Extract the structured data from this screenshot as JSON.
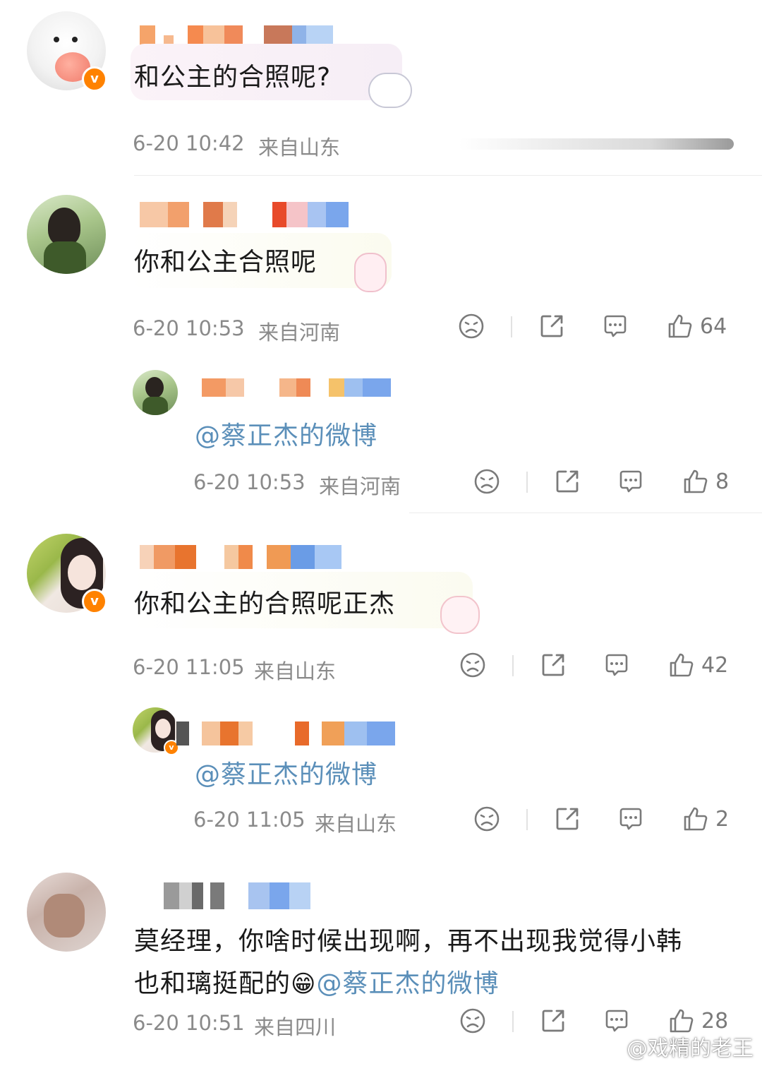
{
  "colors": {
    "accent_orange": "#ff8200",
    "mention_blue": "#5b8fb9",
    "meta_gray": "#8a8a8a"
  },
  "comments": [
    {
      "text": "和公主的合照呢?",
      "date": "6-20 10:42",
      "location": "来自山东",
      "verified": true
    },
    {
      "text": "你和公主合照呢",
      "date": "6-20 10:53",
      "location": "来自河南",
      "likes": "64",
      "verified": false
    },
    {
      "text": "@蔡正杰的微博",
      "date": "6-20 10:53",
      "location": "来自河南",
      "likes": "8",
      "verified": false
    },
    {
      "text": "你和公主的合照呢正杰",
      "date": "6-20 11:05",
      "location": "来自山东",
      "likes": "42",
      "verified": true
    },
    {
      "text": "@蔡正杰的微博",
      "date": "6-20 11:05",
      "location": "来自山东",
      "likes": "2",
      "verified": true
    },
    {
      "text_line1": "莫经理，你啥时候出现啊，再不出现我觉得小韩",
      "text_line2_prefix": "也和璃挺配的",
      "emoji": "😁",
      "mention": "@蔡正杰的微博",
      "date": "6-20 10:51",
      "location": "来自四川",
      "likes": "28",
      "verified": false
    }
  ],
  "icons": [
    "dislike-icon",
    "share-icon",
    "comment-icon",
    "like-icon",
    "verified-badge-icon",
    "weibo-logo-icon"
  ],
  "watermark": "@戏精的老王"
}
